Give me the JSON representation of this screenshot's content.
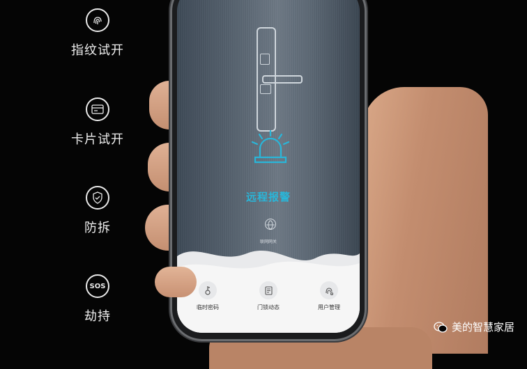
{
  "features": [
    {
      "label": "指纹试开",
      "icon": "fingerprint-icon"
    },
    {
      "label": "卡片试开",
      "icon": "card-icon"
    },
    {
      "label": "防拆",
      "icon": "shield-icon"
    },
    {
      "label": "劫持",
      "icon": "sos-icon",
      "icon_text": "SOS"
    }
  ],
  "screen": {
    "alarm_label": "远程报警",
    "gateway_label": "联网网关",
    "accent_color": "#29b6d9"
  },
  "nav": [
    {
      "label": "临时密码",
      "icon": "key-icon"
    },
    {
      "label": "门锁动态",
      "icon": "document-icon"
    },
    {
      "label": "用户管理",
      "icon": "user-settings-icon"
    }
  ],
  "watermark": {
    "text": "美的智慧家居",
    "icon": "wechat-icon"
  }
}
